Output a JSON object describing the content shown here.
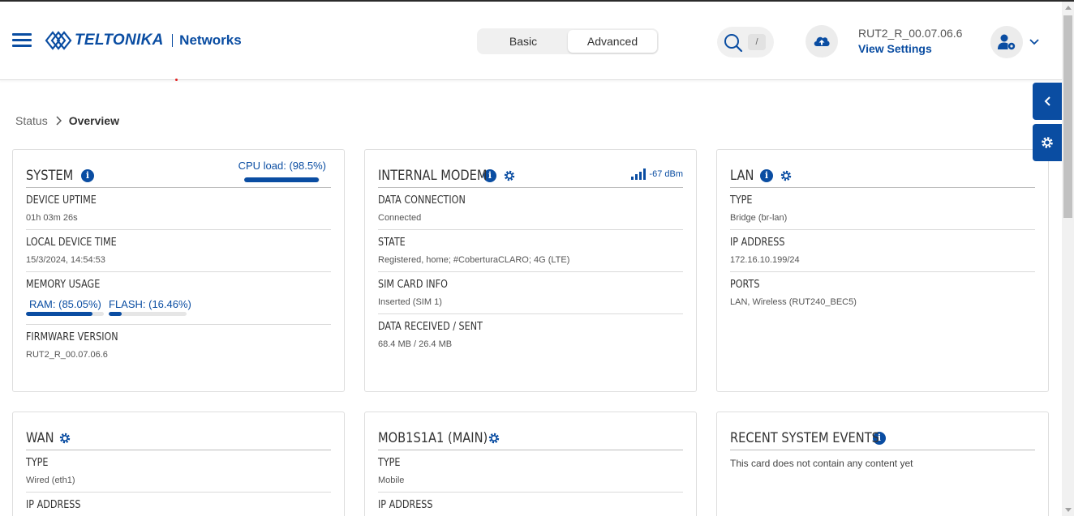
{
  "brand": {
    "logo_text": "TELTONIKA",
    "product": "Networks",
    "color": "#0a4da2"
  },
  "header": {
    "mode_basic": "Basic",
    "mode_advanced": "Advanced",
    "active_mode": "Advanced",
    "search_shortcut": "/",
    "firmware": "RUT2_R_00.07.06.6",
    "view_settings": "View Settings",
    "icons": [
      "menu-icon",
      "search-icon",
      "cloud-upload-icon",
      "user-settings-icon",
      "chevron-down-icon"
    ]
  },
  "breadcrumb": {
    "parent": "Status",
    "current": "Overview"
  },
  "cards": {
    "system": {
      "title": "SYSTEM",
      "cpu_label": "CPU load: (98.5%)",
      "cpu_value": 98.5,
      "fields": {
        "uptime_label": "DEVICE UPTIME",
        "uptime_value": "01h 03m 26s",
        "time_label": "LOCAL DEVICE TIME",
        "time_value": "15/3/2024, 14:54:53",
        "memory_label": "MEMORY USAGE",
        "ram_label": "RAM: (85.05%)",
        "ram_value": 85.05,
        "flash_label": "FLASH: (16.46%)",
        "flash_value": 16.46,
        "firmware_label": "FIRMWARE VERSION",
        "firmware_value": "RUT2_R_00.07.06.6"
      }
    },
    "modem": {
      "title": "INTERNAL MODEM",
      "signal": "-67 dBm",
      "fields": {
        "conn_label": "DATA CONNECTION",
        "conn_value": "Connected",
        "state_label": "STATE",
        "state_value": "Registered, home; #CoberturaCLARO; 4G (LTE)",
        "sim_label": "SIM CARD INFO",
        "sim_value": "Inserted (SIM 1)",
        "data_label": "DATA RECEIVED / SENT",
        "data_value": "68.4 MB / 26.4 MB"
      }
    },
    "lan": {
      "title": "LAN",
      "fields": {
        "type_label": "TYPE",
        "type_value": "Bridge (br-lan)",
        "ip_label": "IP ADDRESS",
        "ip_value": "172.16.10.199/24",
        "ports_label": "PORTS",
        "ports_value": "LAN, Wireless (RUT240_BEC5)"
      }
    },
    "wan": {
      "title": "WAN",
      "fields": {
        "type_label": "TYPE",
        "type_value": "Wired (eth1)",
        "ip_label": "IP ADDRESS"
      }
    },
    "mobile": {
      "title": "MOB1S1A1 (MAIN)",
      "fields": {
        "type_label": "TYPE",
        "type_value": "Mobile",
        "ip_label": "IP ADDRESS"
      }
    },
    "events": {
      "title": "RECENT SYSTEM EVENTS",
      "empty_message": "This card does not contain any content yet"
    }
  }
}
